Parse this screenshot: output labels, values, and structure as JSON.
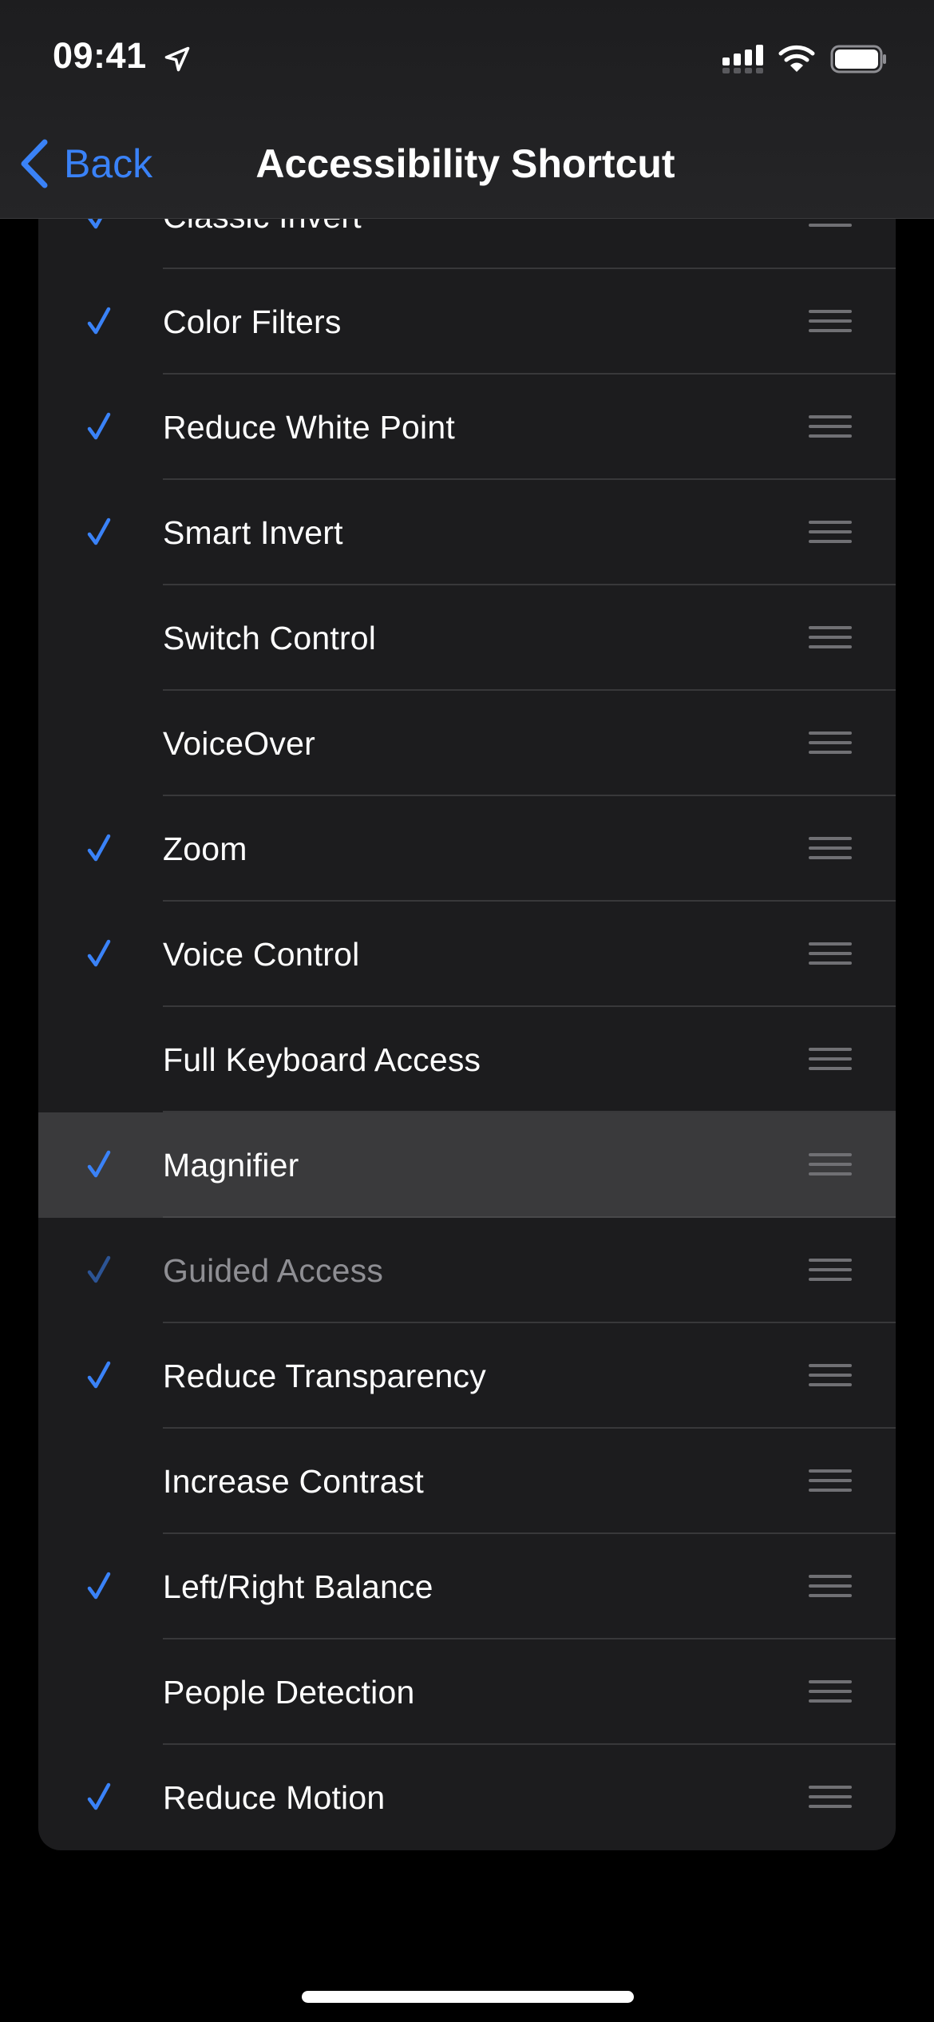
{
  "status_bar": {
    "time": "09:41",
    "icons": [
      "location-arrow-icon",
      "cellular-signal-icon",
      "wifi-icon",
      "battery-icon"
    ]
  },
  "nav": {
    "back_label": "Back",
    "title": "Accessibility Shortcut"
  },
  "colors": {
    "accent": "#3a82f7",
    "background": "#000000",
    "card": "#1c1c1e",
    "highlight_row": "#3a3a3c",
    "dim_text": "#8e8e93"
  },
  "items": [
    {
      "label": "Classic Invert",
      "checked": true,
      "state": "normal"
    },
    {
      "label": "Color Filters",
      "checked": true,
      "state": "normal"
    },
    {
      "label": "Reduce White Point",
      "checked": true,
      "state": "normal"
    },
    {
      "label": "Smart Invert",
      "checked": true,
      "state": "normal"
    },
    {
      "label": "Switch Control",
      "checked": false,
      "state": "normal"
    },
    {
      "label": "VoiceOver",
      "checked": false,
      "state": "normal"
    },
    {
      "label": "Zoom",
      "checked": true,
      "state": "normal"
    },
    {
      "label": "Voice Control",
      "checked": true,
      "state": "normal"
    },
    {
      "label": "Full Keyboard Access",
      "checked": false,
      "state": "normal"
    },
    {
      "label": "Magnifier",
      "checked": true,
      "state": "highlighted"
    },
    {
      "label": "Guided Access",
      "checked": true,
      "state": "dimmed"
    },
    {
      "label": "Reduce Transparency",
      "checked": true,
      "state": "normal"
    },
    {
      "label": "Increase Contrast",
      "checked": false,
      "state": "normal"
    },
    {
      "label": "Left/Right Balance",
      "checked": true,
      "state": "normal"
    },
    {
      "label": "People Detection",
      "checked": false,
      "state": "normal"
    },
    {
      "label": "Reduce Motion",
      "checked": true,
      "state": "normal"
    }
  ]
}
